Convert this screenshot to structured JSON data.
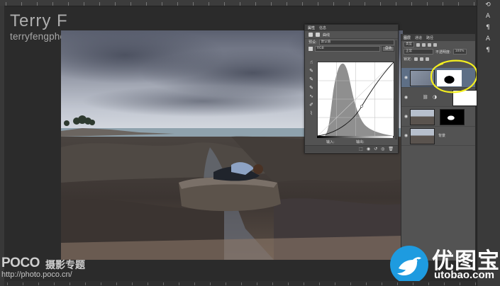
{
  "watermark": {
    "name": "Terry F",
    "url": "terryfengphotography.poco.cn"
  },
  "properties_panel": {
    "tabs": [
      "属性",
      "信息"
    ],
    "header": "曲线",
    "preset_label": "预设:",
    "preset_value": "默认值",
    "channel_value": "RGB",
    "auto_button": "自动",
    "input_label": "输入:",
    "output_label": "输出:"
  },
  "layers_panel": {
    "tabs": [
      "图层",
      "通道",
      "路径"
    ],
    "kind_filter": "类型",
    "blend_mode": "正常",
    "opacity_label": "不透明度:",
    "opacity_value": "100%",
    "fill_label": "锁定:",
    "background_name": "背景"
  },
  "bottom_left": {
    "brand": "POCO",
    "title": "摄影专题",
    "url": "http://photo.poco.cn/"
  },
  "utobao": {
    "cn": "优图宝",
    "url": "utobao.com"
  },
  "colors": {
    "highlight": "#f4ef1f",
    "utobao_blue": "#1e9be0",
    "panel_bg": "#535353",
    "app_bg": "#2b2b2b"
  },
  "icons": {
    "right_bar": [
      "history-icon",
      "color-icon",
      "adjust-icon",
      "type-icon",
      "paragraph-icon"
    ],
    "curve_tools": [
      "on-image-adjust-icon",
      "black-eyedropper-icon",
      "gray-eyedropper-icon",
      "white-eyedropper-icon",
      "curve-point-icon",
      "pencil-icon",
      "smooth-icon"
    ]
  }
}
